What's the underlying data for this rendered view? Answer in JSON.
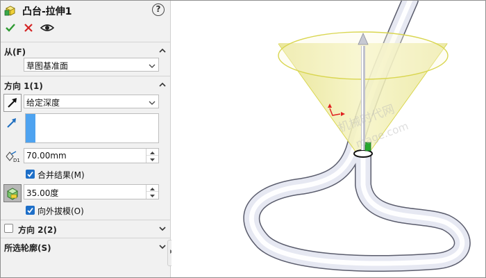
{
  "header": {
    "title": "凸台-拉伸1",
    "help_label": "?"
  },
  "from_section": {
    "title": "从(F)",
    "start_condition": "草图基准面"
  },
  "direction1": {
    "title": "方向 1(1)",
    "end_condition": "给定深度",
    "depth": "70.00mm",
    "merge_label": "合并结果(M)",
    "merge_checked": true,
    "draft_angle": "35.00度",
    "draft_outward_label": "向外拔模(O)",
    "draft_outward_checked": true
  },
  "direction2": {
    "title": "方向 2(2)",
    "checked": false
  },
  "selected_contours": {
    "title": "所选轮廓(S)"
  },
  "viewport": {
    "watermark_cn": "机械时代网",
    "watermark_en": "mage.com",
    "accent_yellow": "#f3f1a8",
    "rim_color": "#d9d650",
    "selection_green": "#27a82d"
  }
}
